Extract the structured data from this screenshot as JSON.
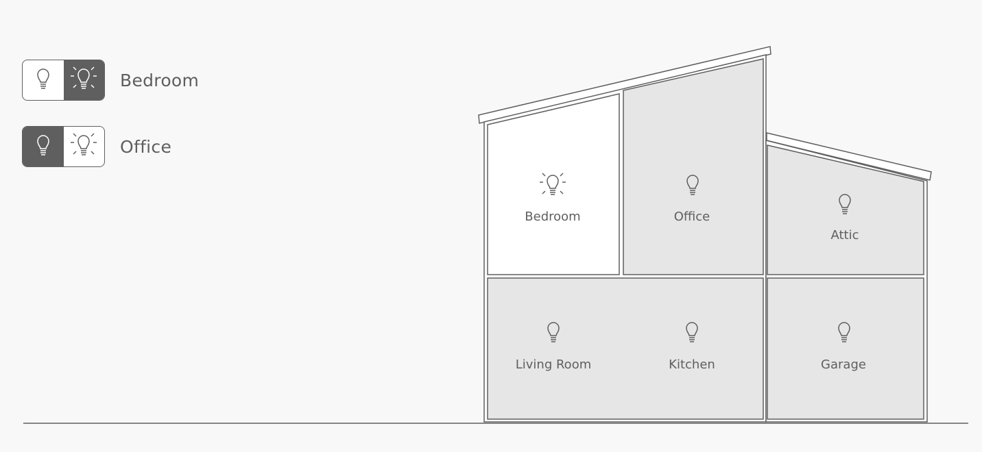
{
  "controls": [
    {
      "room": "Bedroom",
      "state": "on",
      "off_icon": "bulb-off-icon",
      "on_icon": "bulb-on-icon"
    },
    {
      "room": "Office",
      "state": "off",
      "off_icon": "bulb-off-icon",
      "on_icon": "bulb-on-icon"
    }
  ],
  "house": {
    "rooms": [
      {
        "name": "Bedroom",
        "light": "on",
        "icon": "bulb-on-icon"
      },
      {
        "name": "Office",
        "light": "off",
        "icon": "bulb-off-icon"
      },
      {
        "name": "Attic",
        "light": "off",
        "icon": "bulb-off-icon"
      },
      {
        "name": "Living Room",
        "light": "off",
        "icon": "bulb-off-icon"
      },
      {
        "name": "Kitchen",
        "light": "off",
        "icon": "bulb-off-icon"
      },
      {
        "name": "Garage",
        "light": "off",
        "icon": "bulb-off-icon"
      }
    ]
  },
  "colors": {
    "lit_room": "#ffffff",
    "dark_room": "#e6e6e6",
    "outline": "#5f5f5f",
    "background": "#f8f8f8"
  }
}
